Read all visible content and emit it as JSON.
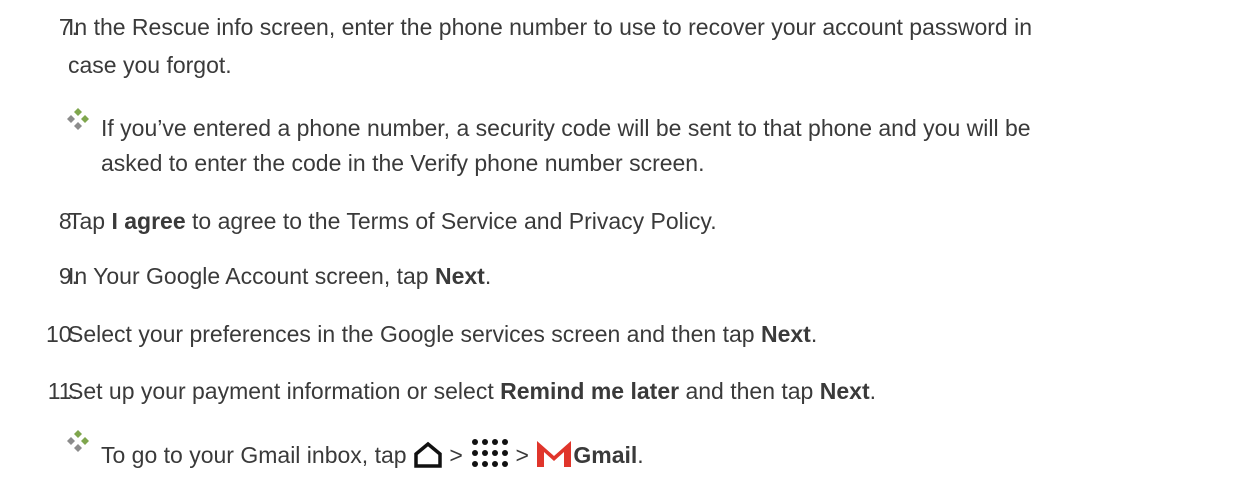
{
  "steps": [
    {
      "num": "7.",
      "lines": [
        "In the Rescue info screen, enter the phone number to use to recover your account password in",
        "case you forgot."
      ]
    },
    {
      "num": "8.",
      "pre": "Tap ",
      "bold": "I agree",
      "post": " to agree to the Terms of Service and Privacy Policy."
    },
    {
      "num": "9.",
      "pre": "In Your Google Account screen, tap ",
      "bold": "Next",
      "post": "."
    },
    {
      "num": "10.",
      "pre": "Select your preferences in the Google services screen and then tap ",
      "bold": "Next",
      "post": "."
    },
    {
      "num": "11.",
      "pre": "Set up your payment information or select ",
      "bold": "Remind me later",
      "mid": " and then tap ",
      "bold2": "Next",
      "post": "."
    }
  ],
  "notes": {
    "note1": [
      "If you’ve entered a phone number, a security code will be sent to that phone and you will be",
      "asked to enter the code in the Verify phone number screen."
    ],
    "note2": {
      "pre": "To go to your Gmail inbox, tap ",
      "sep1": " > ",
      "sep2": " > ",
      "bold": "Gmail",
      "post": "."
    }
  },
  "icons": {
    "bullet": "diamond-bullet-icon",
    "home": "home-icon",
    "apps": "apps-grid-icon",
    "gmail": "gmail-icon"
  },
  "colors": {
    "text": "#3a3a3a",
    "gmail_red": "#e0352b",
    "bullet_green": "#7fa64d",
    "bullet_gray": "#8c8c8c"
  }
}
